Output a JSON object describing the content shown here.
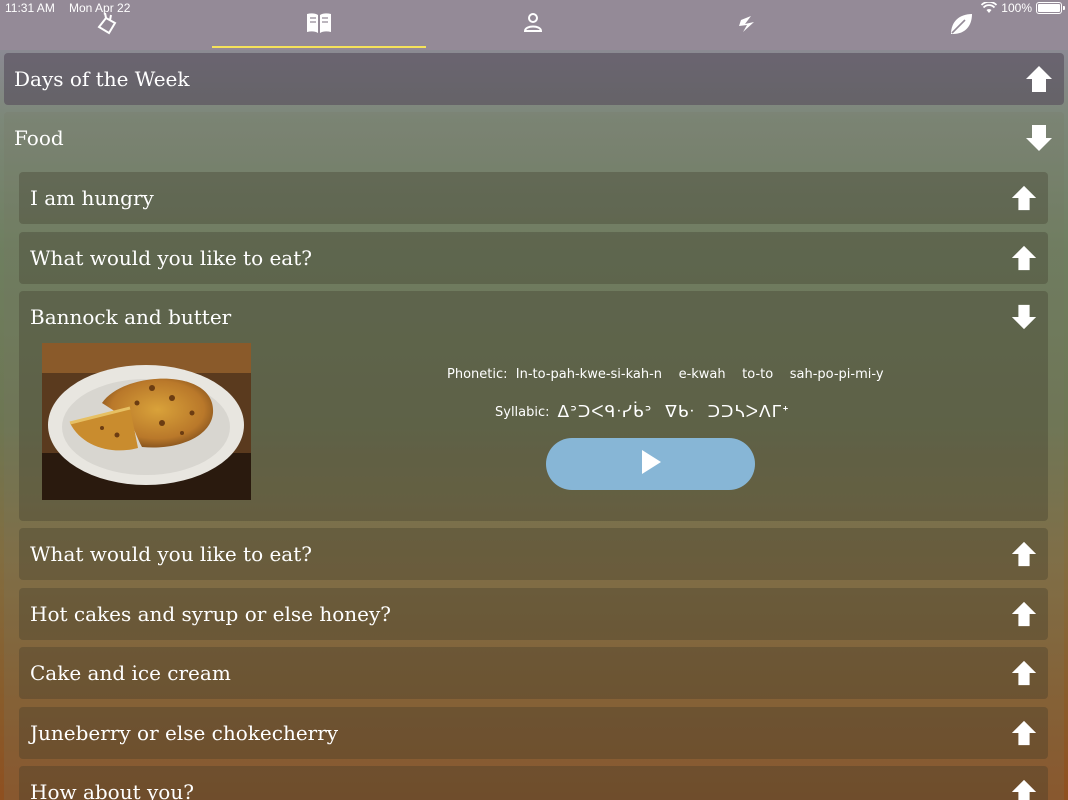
{
  "status_bar": {
    "time": "11:31 AM",
    "date": "Mon Apr 22",
    "battery": "100%"
  },
  "tabs": [
    {
      "icon": "hand-icon",
      "active": false
    },
    {
      "icon": "book-icon",
      "active": true
    },
    {
      "icon": "person-icon",
      "active": false
    },
    {
      "icon": "lightning-icon",
      "active": false
    },
    {
      "icon": "leaf-icon",
      "active": false
    }
  ],
  "sections": {
    "days": {
      "title": "Days of the Week",
      "arrow": "up"
    },
    "food": {
      "title": "Food",
      "arrow": "down"
    }
  },
  "food_items": [
    {
      "label": "I am hungry",
      "arrow": "up"
    },
    {
      "label": "What would you like to eat?",
      "arrow": "up"
    },
    {
      "label": "Bannock and butter",
      "arrow": "down"
    },
    {
      "label": "What would you like to eat?",
      "arrow": "up"
    },
    {
      "label": "Hot cakes and syrup or else honey?",
      "arrow": "up"
    },
    {
      "label": "Cake and ice cream",
      "arrow": "up"
    },
    {
      "label": "Juneberry or else chokecherry",
      "arrow": "up"
    },
    {
      "label": "How about you?",
      "arrow": "up"
    }
  ],
  "expanded": {
    "phonetic_label": "Phonetic:",
    "phonetic_text": "In-to-pah-kwe-si-kah-n    e-kwah    to-to    sah-po-pi-mi-y",
    "syllabic_label": "Syllabic:",
    "syllabic_text": "ᐃᐣᑐᐸᑫᐧᓯᑳᐣ  ᐁᑲᐧ  ᑐᑐᓴᐳᐱᒥᕀ",
    "image": "bannock-photo",
    "play": "play-icon"
  },
  "colors": {
    "tab_indicator": "#f5e25a",
    "play_button": "#87b6d6"
  }
}
